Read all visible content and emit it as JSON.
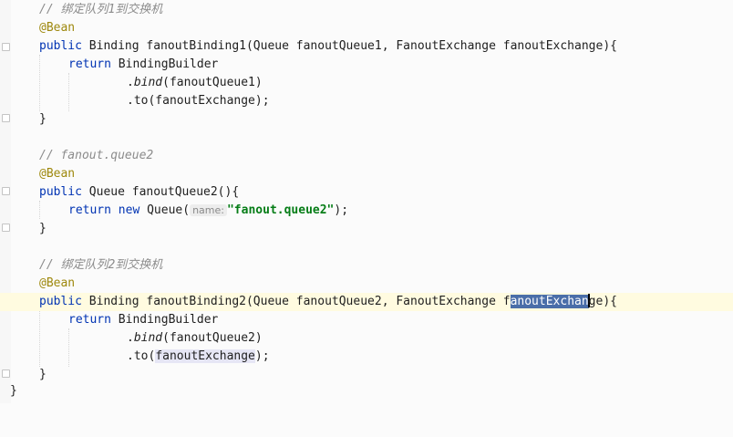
{
  "editor": {
    "lines": [
      {
        "id": "l1",
        "comment": "// 绑定队列1到交换机"
      },
      {
        "id": "l2",
        "annotation": "@Bean"
      },
      {
        "id": "l3",
        "kw": "public",
        "rest": " Binding fanoutBinding1(Queue fanoutQueue1, FanoutExchange fanoutExchange){"
      },
      {
        "id": "l4",
        "kw": "return",
        "rest": " BindingBuilder"
      },
      {
        "id": "l5",
        "dot": ".",
        "method": "bind",
        "rest": "(fanoutQueue1)"
      },
      {
        "id": "l6",
        "text": ".to(fanoutExchange);"
      },
      {
        "id": "l7",
        "text": "}"
      },
      {
        "id": "l8",
        "comment": "// fanout.queue2"
      },
      {
        "id": "l9",
        "annotation": "@Bean"
      },
      {
        "id": "l10",
        "kw": "public",
        "rest": " Queue fanoutQueue2(){"
      },
      {
        "id": "l11",
        "kw": "return",
        "kw2": " new",
        "rest1": " Queue(",
        "hint": "name:",
        "str": "\"fanout.queue2\"",
        "rest2": ");"
      },
      {
        "id": "l12",
        "text": "}"
      },
      {
        "id": "l13",
        "comment": "// 绑定队列2到交换机"
      },
      {
        "id": "l14",
        "annotation": "@Bean"
      },
      {
        "id": "l15",
        "kw": "public",
        "rest1": " Binding fanoutBinding2(Queue fanoutQueue2, FanoutExchange f",
        "sel": "anoutExchan",
        "after_caret": "ge",
        "rest2": "){"
      },
      {
        "id": "l16",
        "kw": "return",
        "rest": " BindingBuilder"
      },
      {
        "id": "l17",
        "dot": ".",
        "method": "bind",
        "rest": "(fanoutQueue2)"
      },
      {
        "id": "l18",
        "pre": ".to(",
        "usage": "fanoutExchange",
        "post": ");"
      },
      {
        "id": "l19",
        "text": "}"
      },
      {
        "id": "l20",
        "text": "}"
      }
    ]
  }
}
